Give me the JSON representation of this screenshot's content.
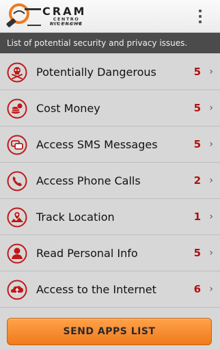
{
  "app": {
    "logo": {
      "word": "CRAM",
      "line1": "CENTRO RICERCHE",
      "line2": "ANTI-MALWARE"
    },
    "menu_icon": "overflow-menu-icon"
  },
  "subtitle": "List of potential security and privacy issues.",
  "categories": [
    {
      "label": "Potentially Dangerous",
      "count": "5",
      "icon": "skull-crossbones-icon"
    },
    {
      "label": "Cost Money",
      "count": "5",
      "icon": "coins-icon"
    },
    {
      "label": "Access SMS Messages",
      "count": "5",
      "icon": "sms-bubbles-icon"
    },
    {
      "label": "Access Phone Calls",
      "count": "2",
      "icon": "phone-handset-icon"
    },
    {
      "label": "Track Location",
      "count": "1",
      "icon": "map-marker-icon"
    },
    {
      "label": "Read Personal Info",
      "count": "5",
      "icon": "person-icon"
    },
    {
      "label": "Access to the Internet",
      "count": "6",
      "icon": "cloud-icon"
    }
  ],
  "chevron": "›",
  "send_button": "SEND APPS LIST",
  "colors": {
    "accent": "#f58a2a",
    "count": "#b01010",
    "icon_ring": "#c01818",
    "subbar": "#4b4b4b",
    "background": "#d7d7d7"
  }
}
